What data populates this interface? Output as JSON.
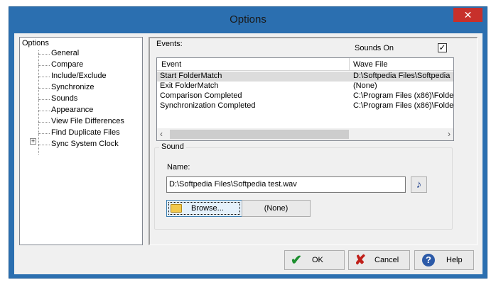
{
  "window": {
    "title": "Options"
  },
  "titlebar": {
    "close_glyph": "✕"
  },
  "tree": {
    "root": "Options",
    "items": [
      "General",
      "Compare",
      "Include/Exclude",
      "Synchronize",
      "Sounds",
      "Appearance",
      "View File Differences",
      "Find Duplicate Files",
      "Sync System Clock"
    ],
    "expander_glyph": "+"
  },
  "events": {
    "label": "Events:",
    "sounds_on_label": "Sounds On",
    "sounds_on_checked": "✓",
    "columns": [
      "Event",
      "Wave File"
    ],
    "rows": [
      {
        "event": "Start FolderMatch",
        "wave": "D:\\Softpedia Files\\Softpedia"
      },
      {
        "event": "Exit FolderMatch",
        "wave": "(None)"
      },
      {
        "event": "Comparison Completed",
        "wave": "C:\\Program Files (x86)\\Folde"
      },
      {
        "event": "Synchronization Completed",
        "wave": "C:\\Program Files (x86)\\Folde"
      }
    ],
    "selected_row": 0,
    "scroll_left_glyph": "‹",
    "scroll_right_glyph": "›"
  },
  "sound": {
    "group_label": "Sound",
    "name_label": "Name:",
    "path_value": "D:\\Softpedia Files\\Softpedia test.wav",
    "play_glyph": "♪",
    "browse_label": "Browse...",
    "none_label": "(None)"
  },
  "buttons": {
    "ok": "OK",
    "cancel": "Cancel",
    "help": "Help",
    "ok_glyph": "✔",
    "cancel_glyph": "✘",
    "help_glyph": "?"
  },
  "colors": {
    "frame": "#2b6fb0",
    "close": "#c7302b",
    "ok_check": "#1d8f2f",
    "cancel_x": "#c0201a",
    "help_icon": "#2c5aa8"
  }
}
